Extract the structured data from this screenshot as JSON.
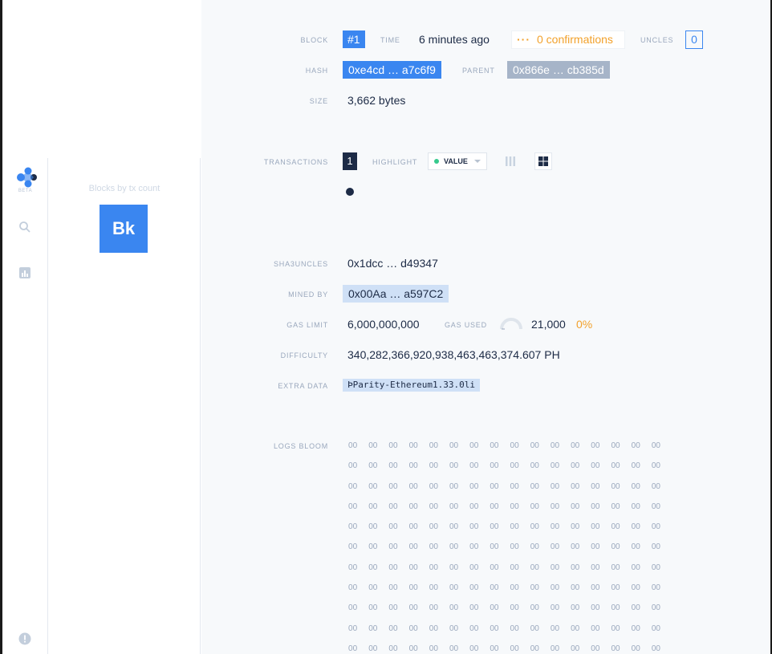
{
  "nav": {
    "beta": "BETA",
    "blocks_title": "Blocks by tx count",
    "tile_label": "Bk"
  },
  "block": {
    "block_label": "BLOCK",
    "number": "#1",
    "time_label": "TIME",
    "time": "6 minutes ago",
    "confirmations": "0 confirmations",
    "uncles_label": "UNCLES",
    "uncles": "0",
    "hash_label": "HASH",
    "hash": "0xe4cd … a7c6f9",
    "parent_label": "PARENT",
    "parent": "0x866e … cb385d",
    "size_label": "SIZE",
    "size": "3,662 bytes"
  },
  "transactions": {
    "label": "TRANSACTIONS",
    "count": "1",
    "highlight_label": "HIGHLIGHT",
    "highlight_value": "VALUE"
  },
  "details": {
    "sha3_label": "SHA3UNCLES",
    "sha3": "0x1dcc … d49347",
    "miner_label": "MINED BY",
    "miner": "0x00Aa … a597C2",
    "gas_limit_label": "GAS LIMIT",
    "gas_limit": "6,000,000,000",
    "gas_used_label": "GAS USED",
    "gas_used": "21,000",
    "gas_used_pct": "0%",
    "gas_used_fraction": 0.0,
    "difficulty_label": "DIFFICULTY",
    "difficulty": "340,282,366,920,938,463,463,374.607 PH",
    "extra_label": "EXTRA DATA",
    "extra": "ÞParity-Ethereum1.33.0li"
  },
  "logs_bloom": {
    "label": "LOGS BLOOM",
    "cell": "00",
    "rows": 11,
    "cols": 16
  },
  "colors": {
    "accent": "#3a86f0",
    "warning": "#f2a12b",
    "dark": "#1d2b46",
    "muted": "#9aa8bd"
  }
}
